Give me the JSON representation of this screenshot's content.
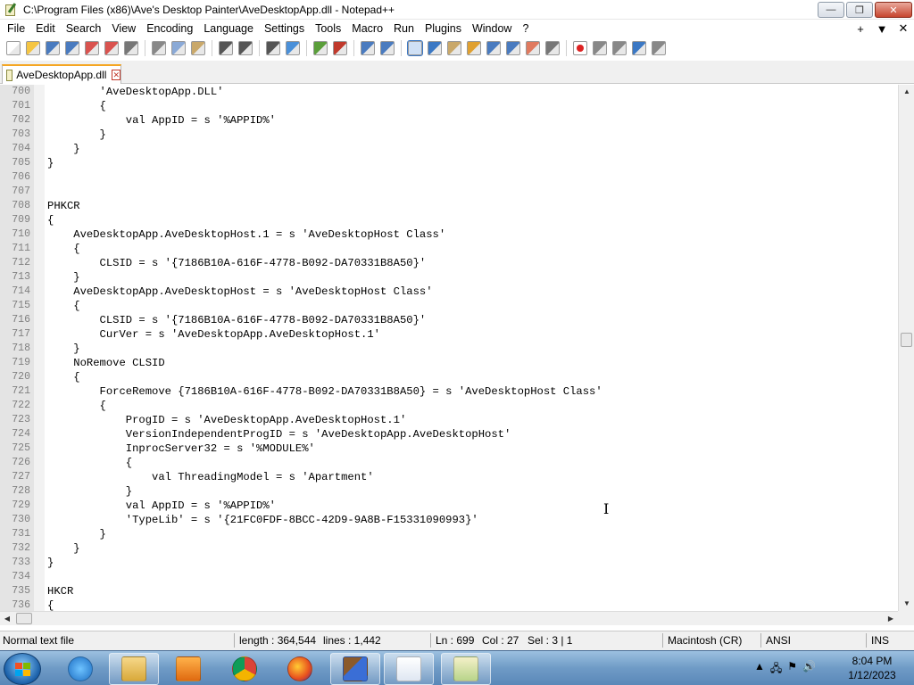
{
  "window": {
    "title": "C:\\Program Files (x86)\\Ave's Desktop Painter\\AveDesktopApp.dll - Notepad++",
    "minimize_label": "—",
    "maximize_label": "❐",
    "close_label": "✕"
  },
  "menu": {
    "items": [
      "File",
      "Edit",
      "Search",
      "View",
      "Encoding",
      "Language",
      "Settings",
      "Tools",
      "Macro",
      "Run",
      "Plugins",
      "Window",
      "?"
    ],
    "plus": "+",
    "dropdown": "▼",
    "close": "✕"
  },
  "toolbar": {
    "icons": [
      "new-file-icon",
      "open-file-icon",
      "save-icon",
      "save-all-icon",
      "close-icon",
      "close-all-icon",
      "print-icon",
      "cut-icon",
      "copy-icon",
      "paste-icon",
      "undo-icon",
      "redo-icon",
      "find-icon",
      "replace-icon",
      "zoom-in-icon",
      "zoom-out-icon",
      "sync-v-icon",
      "sync-h-icon",
      "word-wrap-icon",
      "show-all-chars-icon",
      "indent-guide-icon",
      "udl-icon",
      "doc-map-icon",
      "function-list-icon",
      "folder-workspace-icon",
      "monitor-icon",
      "record-macro-icon",
      "stop-macro-icon",
      "play-macro-icon",
      "run-macro-icon",
      "save-macro-icon"
    ]
  },
  "tab": {
    "label": "AveDesktopApp.dll",
    "close": "✕"
  },
  "editor": {
    "lines": [
      {
        "n": "700",
        "t": "        'AveDesktopApp.DLL'"
      },
      {
        "n": "701",
        "t": "        {"
      },
      {
        "n": "702",
        "t": "            val AppID = s '%APPID%'"
      },
      {
        "n": "703",
        "t": "        }"
      },
      {
        "n": "704",
        "t": "    }"
      },
      {
        "n": "705",
        "t": "}"
      },
      {
        "n": "706",
        "t": ""
      },
      {
        "n": "707",
        "t": ""
      },
      {
        "n": "708",
        "t": "PHKCR"
      },
      {
        "n": "709",
        "t": "{"
      },
      {
        "n": "710",
        "t": "    AveDesktopApp.AveDesktopHost.1 = s 'AveDesktopHost Class'"
      },
      {
        "n": "711",
        "t": "    {"
      },
      {
        "n": "712",
        "t": "        CLSID = s '{7186B10A-616F-4778-B092-DA70331B8A50}'"
      },
      {
        "n": "713",
        "t": "    }"
      },
      {
        "n": "714",
        "t": "    AveDesktopApp.AveDesktopHost = s 'AveDesktopHost Class'"
      },
      {
        "n": "715",
        "t": "    {"
      },
      {
        "n": "716",
        "t": "        CLSID = s '{7186B10A-616F-4778-B092-DA70331B8A50}'"
      },
      {
        "n": "717",
        "t": "        CurVer = s 'AveDesktopApp.AveDesktopHost.1'"
      },
      {
        "n": "718",
        "t": "    }"
      },
      {
        "n": "719",
        "t": "    NoRemove CLSID"
      },
      {
        "n": "720",
        "t": "    {"
      },
      {
        "n": "721",
        "t": "        ForceRemove {7186B10A-616F-4778-B092-DA70331B8A50} = s 'AveDesktopHost Class'"
      },
      {
        "n": "722",
        "t": "        {"
      },
      {
        "n": "723",
        "t": "            ProgID = s 'AveDesktopApp.AveDesktopHost.1'"
      },
      {
        "n": "724",
        "t": "            VersionIndependentProgID = s 'AveDesktopApp.AveDesktopHost'"
      },
      {
        "n": "725",
        "t": "            InprocServer32 = s '%MODULE%'"
      },
      {
        "n": "726",
        "t": "            {"
      },
      {
        "n": "727",
        "t": "                val ThreadingModel = s 'Apartment'"
      },
      {
        "n": "728",
        "t": "            }"
      },
      {
        "n": "729",
        "t": "            val AppID = s '%APPID%'"
      },
      {
        "n": "730",
        "t": "            'TypeLib' = s '{21FC0FDF-8BCC-42D9-9A8B-F15331090993}'"
      },
      {
        "n": "731",
        "t": "        }"
      },
      {
        "n": "732",
        "t": "    }"
      },
      {
        "n": "733",
        "t": "}"
      },
      {
        "n": "734",
        "t": ""
      },
      {
        "n": "735",
        "t": "HKCR"
      },
      {
        "n": "736",
        "t": "{"
      }
    ]
  },
  "status": {
    "filetype": "Normal text file",
    "length": "length : 364,544",
    "lines": "lines : 1,442",
    "ln": "Ln : 699",
    "col": "Col : 27",
    "sel": "Sel : 3 | 1",
    "eol": "Macintosh (CR)",
    "encoding": "ANSI",
    "mode": "INS"
  },
  "taskbar": {
    "apps": [
      "internet-explorer-icon",
      "file-explorer-icon",
      "media-player-icon",
      "chrome-icon",
      "firefox-icon",
      "paint-brush-icon",
      "notepad-icon",
      "notepadpp-icon"
    ],
    "time": "8:04 PM",
    "date": "1/12/2023"
  }
}
